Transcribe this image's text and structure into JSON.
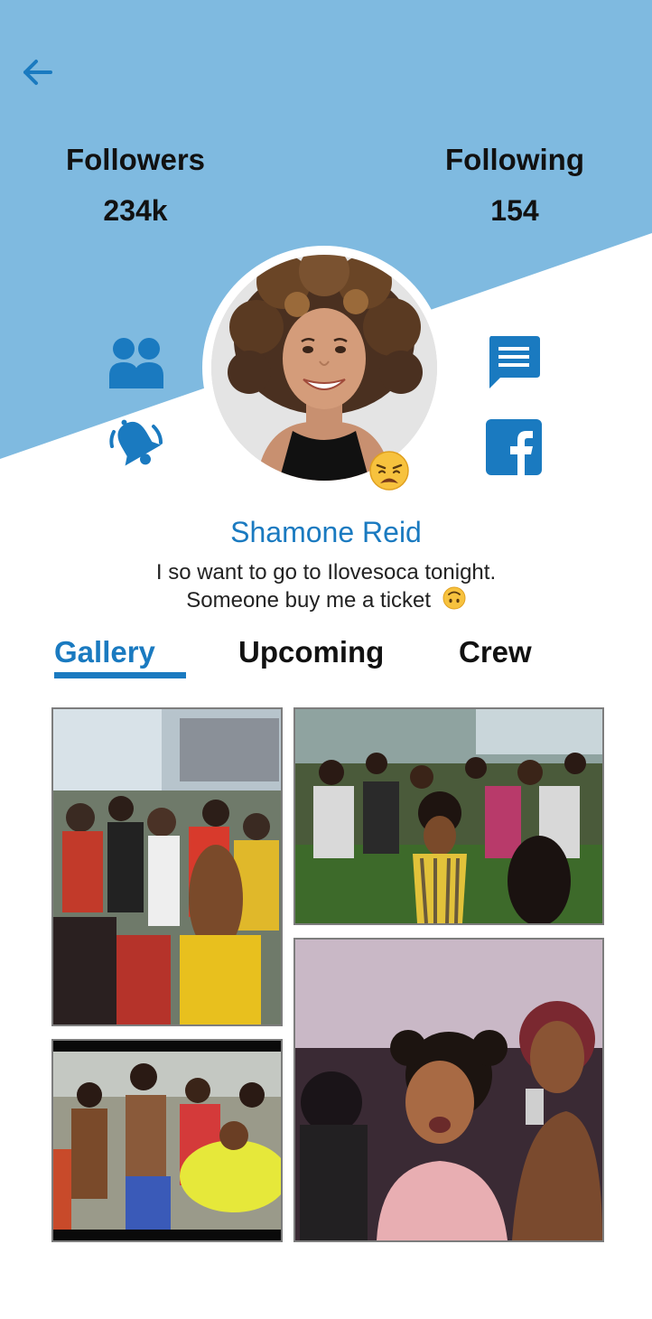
{
  "header": {
    "back_icon": "arrow-left-icon",
    "accent_color": "#1a7ac0",
    "bg_color": "#7fbae0"
  },
  "stats": {
    "followers": {
      "label": "Followers",
      "value": "234k"
    },
    "following": {
      "label": "Following",
      "value": "154"
    }
  },
  "actions": {
    "left": [
      "group-icon",
      "bell-icon"
    ],
    "right": [
      "message-icon",
      "facebook-icon"
    ]
  },
  "profile": {
    "name": "Shamone Reid",
    "mood_emoji": "weary-face-emoji",
    "bio_line1": "I so want to go to Ilovesoca tonight.",
    "bio_line2": "Someone buy me a ticket",
    "bio_emoji": "upside-down-face-emoji"
  },
  "tabs": [
    {
      "label": "Gallery",
      "active": true
    },
    {
      "label": "Upcoming",
      "active": false
    },
    {
      "label": "Crew",
      "active": false
    }
  ],
  "gallery": {
    "photos": [
      "party-crowd-photo",
      "outdoor-dance-photo",
      "festival-dancers-photo",
      "club-selfie-photo"
    ]
  }
}
